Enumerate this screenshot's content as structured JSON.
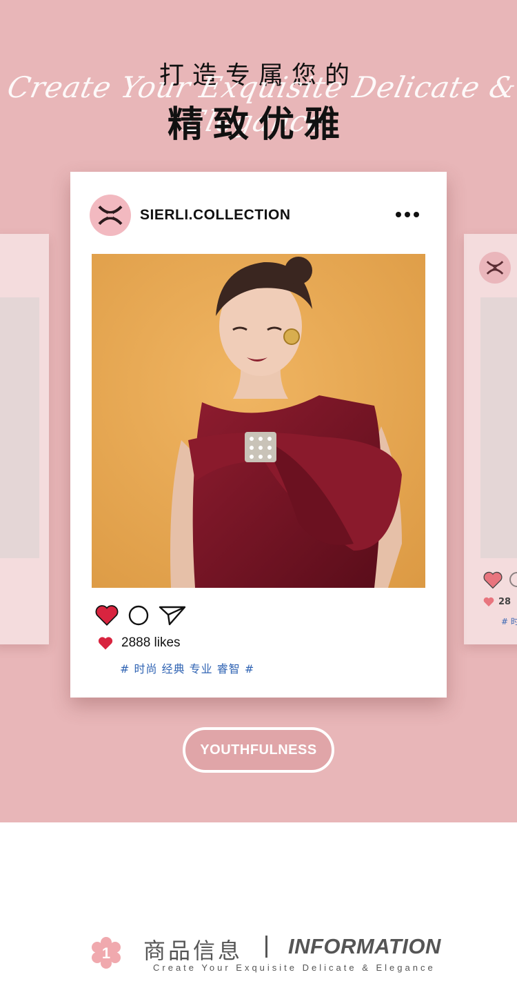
{
  "header": {
    "title_line1": "打造专属您的",
    "script_text": "Create Your Exquisite Delicate & Elegance",
    "title_line2": "精致优雅"
  },
  "post": {
    "username": "SIERLI.COLLECTION",
    "likes": "2888 likes",
    "hashtags": "# 时尚 经典 专业 睿智 #",
    "more_icon": "more-dots-icon",
    "action_icons": [
      "heart-icon",
      "comment-icon",
      "send-icon"
    ]
  },
  "side_post": {
    "likes_partial": "28",
    "tag_partial": "# 时"
  },
  "badge": {
    "label": "YOUTHFULNESS"
  },
  "info": {
    "number": "1",
    "title_cn": "商品信息",
    "title_en": "INFORMATION",
    "subtitle": "Create Your Exquisite Delicate & Elegance"
  },
  "colors": {
    "hero_bg": "#e8b6b8",
    "heart": "#d8243f",
    "hashtag": "#2f63b3",
    "avatar_bg": "#f2b9c0",
    "dress": "#7b1626",
    "photo_bg": "#e9a64f"
  }
}
